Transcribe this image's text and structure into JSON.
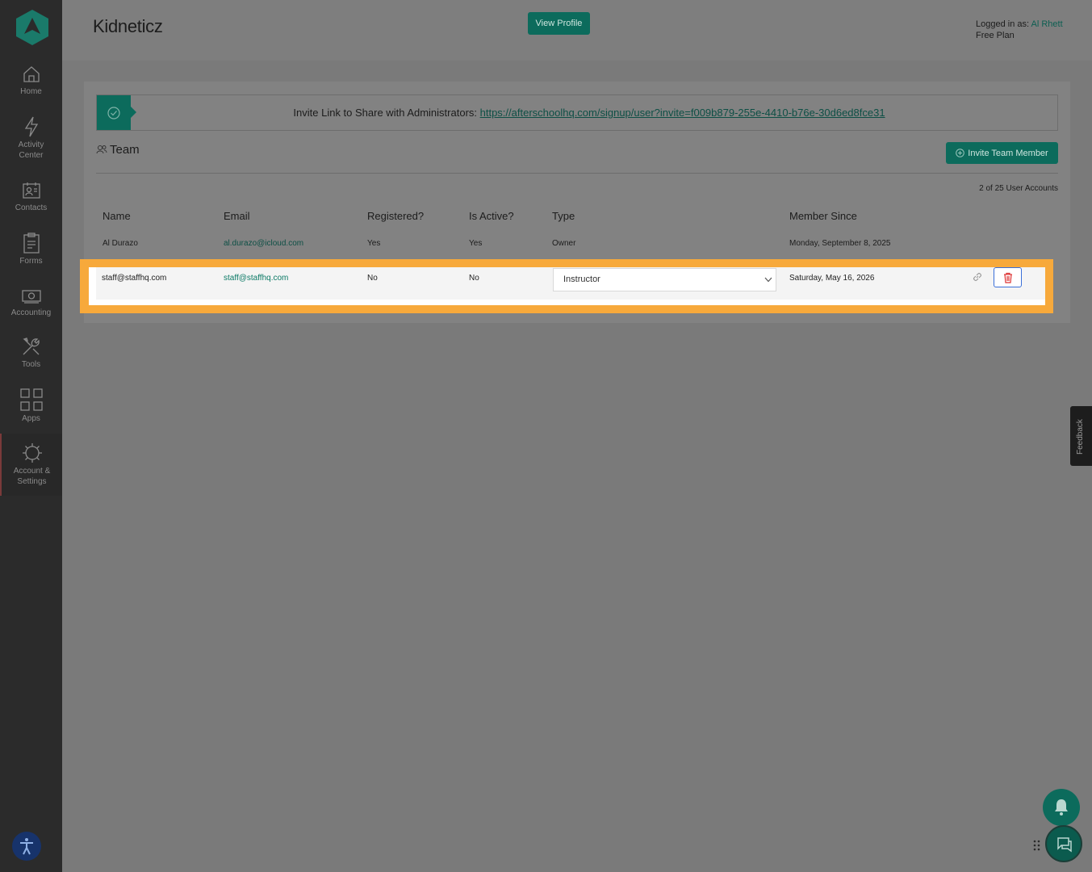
{
  "sidebar": {
    "items": [
      {
        "label": "Home",
        "icon": "home-icon"
      },
      {
        "label": "Activity\nCenter",
        "icon": "lightning-icon"
      },
      {
        "label": "Contacts",
        "icon": "contacts-icon"
      },
      {
        "label": "Forms",
        "icon": "clipboard-icon"
      },
      {
        "label": "Accounting",
        "icon": "cash-icon"
      },
      {
        "label": "Tools",
        "icon": "tools-icon"
      },
      {
        "label": "Apps",
        "icon": "apps-grid-icon"
      },
      {
        "label": "Account &\nSettings",
        "icon": "gear-icon",
        "active": true
      }
    ]
  },
  "header": {
    "org_name": "Kidneticz",
    "view_profile_label": "View Profile",
    "logged_in_prefix": "Logged in as: ",
    "user_name": "Al Rhett",
    "plan": "Free Plan"
  },
  "invite": {
    "text": "Invite Link to Share with Administrators: ",
    "link": "https://afterschoolhq.com/signup/user?invite=f009b879-255e-4410-b76e-30d6ed8fce31"
  },
  "team": {
    "title": "Team",
    "invite_button_label": "Invite Team Member",
    "account_count": "2 of 25 User Accounts",
    "columns": [
      "Name",
      "Email",
      "Registered?",
      "Is Active?",
      "Type",
      "Member Since"
    ],
    "rows": [
      {
        "name": "Al Durazo",
        "email": "al.durazo@icloud.com",
        "registered": "Yes",
        "active": "Yes",
        "type": "Owner",
        "since": "Monday, September 8, 2025"
      },
      {
        "name": "staff@staffhq.com",
        "email": "staff@staffhq.com",
        "registered": "No",
        "active": "No",
        "type": "Instructor",
        "since": "Saturday, May 16, 2026"
      }
    ]
  },
  "feedback_label": "Feedback",
  "colors": {
    "brand": "#0c6b5c",
    "highlight": "#f7a93b",
    "sidebar": "#2b2b2b"
  }
}
